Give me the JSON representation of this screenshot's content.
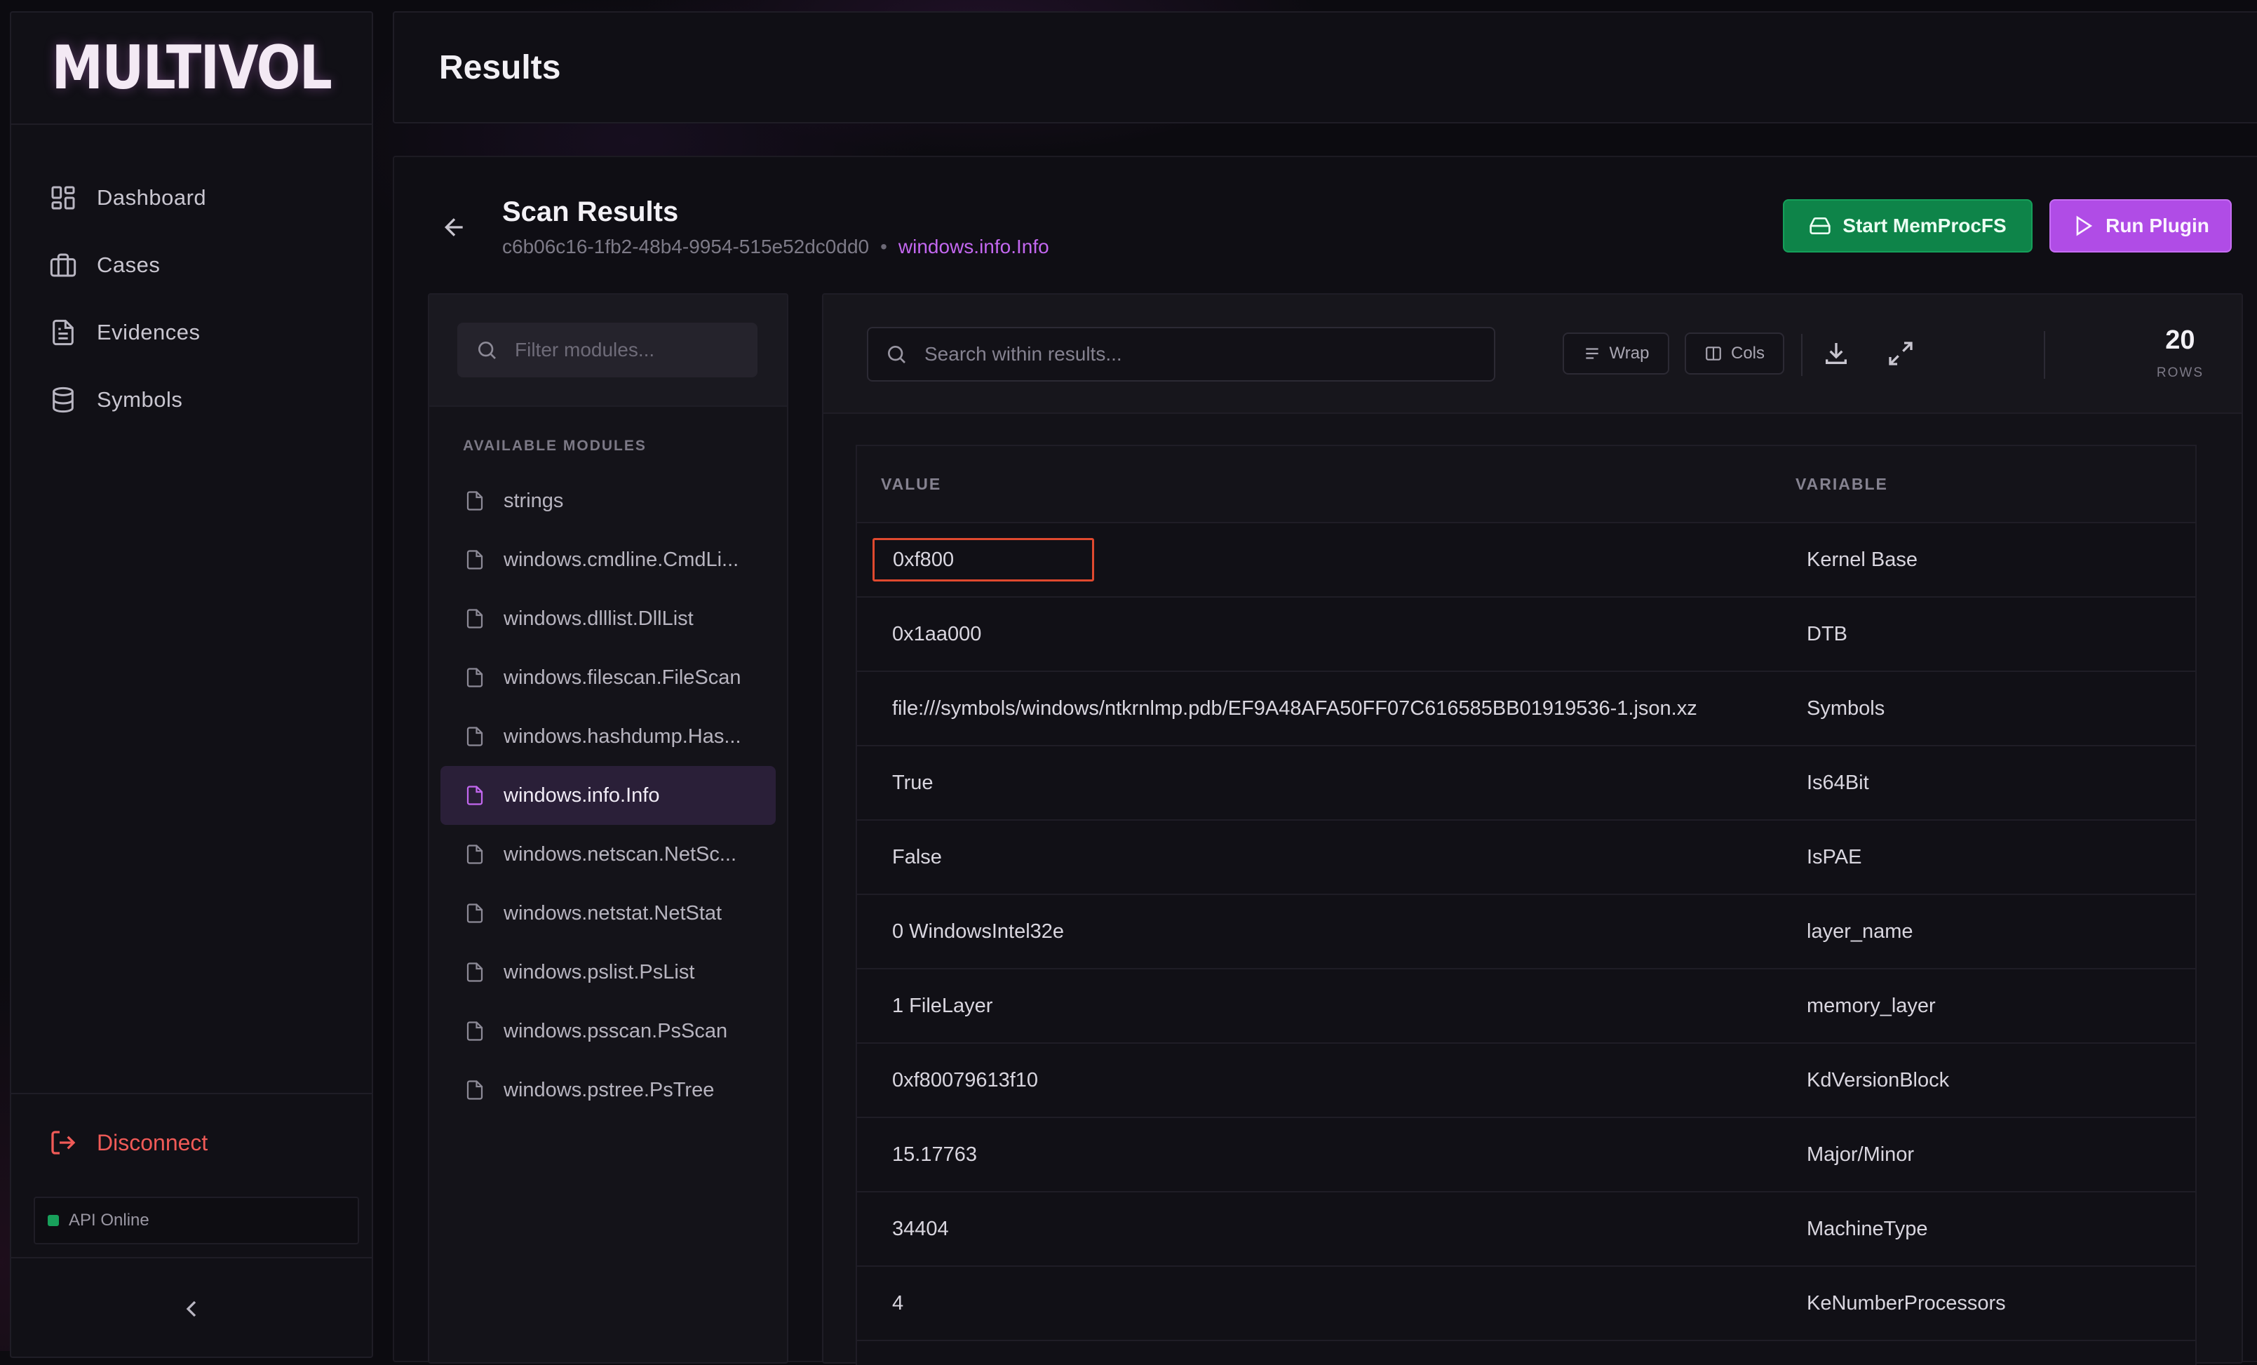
{
  "app": {
    "logo": "MULTIVOL"
  },
  "sidebar": {
    "items": [
      {
        "label": "Dashboard",
        "icon": "dashboard-grid-icon"
      },
      {
        "label": "Cases",
        "icon": "briefcase-icon"
      },
      {
        "label": "Evidences",
        "icon": "document-icon"
      },
      {
        "label": "Symbols",
        "icon": "database-icon"
      }
    ],
    "disconnect_label": "Disconnect",
    "api_status": "API Online"
  },
  "header": {
    "title": "Results"
  },
  "scan": {
    "title": "Scan Results",
    "id": "c6b06c16-1fb2-48b4-9954-515e52dc0dd0",
    "separator": "•",
    "plugin": "windows.info.Info",
    "start_memprocfs_label": "Start MemProcFS",
    "run_plugin_label": "Run Plugin"
  },
  "modules": {
    "filter_placeholder": "Filter modules...",
    "section_label": "AVAILABLE MODULES",
    "items": [
      "strings",
      "windows.cmdline.CmdLi...",
      "windows.dlllist.DllList",
      "windows.filescan.FileScan",
      "windows.hashdump.Has...",
      "windows.info.Info",
      "windows.netscan.NetSc...",
      "windows.netstat.NetStat",
      "windows.pslist.PsList",
      "windows.psscan.PsScan",
      "windows.pstree.PsTree"
    ],
    "active_index": 5
  },
  "results": {
    "search_placeholder": "Search within results...",
    "wrap_label": "Wrap",
    "cols_label": "Cols",
    "row_count": "20",
    "row_count_label": "ROWS",
    "columns": [
      "VALUE",
      "VARIABLE"
    ],
    "rows": [
      {
        "value": "0xf800",
        "variable": "Kernel Base"
      },
      {
        "value": "0x1aa000",
        "variable": "DTB"
      },
      {
        "value": "file:///symbols/windows/ntkrnlmp.pdb/EF9A48AFA50FF07C616585BB01919536-1.json.xz",
        "variable": "Symbols"
      },
      {
        "value": "True",
        "variable": "Is64Bit"
      },
      {
        "value": "False",
        "variable": "IsPAE"
      },
      {
        "value": "0 WindowsIntel32e",
        "variable": "layer_name"
      },
      {
        "value": "1 FileLayer",
        "variable": "memory_layer"
      },
      {
        "value": "0xf80079613f10",
        "variable": "KdVersionBlock"
      },
      {
        "value": "15.17763",
        "variable": "Major/Minor"
      },
      {
        "value": "34404",
        "variable": "MachineType"
      },
      {
        "value": "4",
        "variable": "KeNumberProcessors"
      }
    ]
  },
  "colors": {
    "accent_purple": "#c367f0",
    "memprocfs_green": "#0e8449",
    "disconnect_red": "#f05a57",
    "selection_border": "#e0492f"
  }
}
